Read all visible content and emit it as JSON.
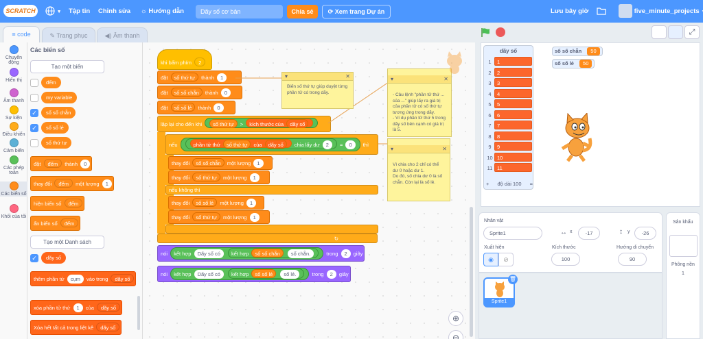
{
  "menu": {
    "logo": "SCRATCH",
    "language_icon": "globe-icon",
    "file": "Tập tin",
    "edit": "Chỉnh sửa",
    "tutorials": "Hướng dẫn",
    "project_title": "Dãy số cơ bản",
    "share": "Chia sẻ",
    "see_project": "Xem trang Dự án",
    "save_now": "Lưu bây giờ",
    "username": "five_minute_projects"
  },
  "tabs": {
    "code": "code",
    "costumes": "Trang phục",
    "sounds": "Âm thanh"
  },
  "categories": [
    {
      "label": "Chuyển động",
      "color": "#4c97ff"
    },
    {
      "label": "Hiển thị",
      "color": "#9966ff"
    },
    {
      "label": "Âm thanh",
      "color": "#cf63cf"
    },
    {
      "label": "Sự kiện",
      "color": "#ffbf00"
    },
    {
      "label": "Điều khiển",
      "color": "#ffab19"
    },
    {
      "label": "Cảm biến",
      "color": "#5cb1d6"
    },
    {
      "label": "Các phép toán",
      "color": "#59c059"
    },
    {
      "label": "Các biến số",
      "color": "#ff8c1a"
    },
    {
      "label": "Khối của tôi",
      "color": "#ff6680"
    }
  ],
  "palette": {
    "heading": "Các biến số",
    "make_var": "Tạo một biến",
    "vars": [
      "đếm",
      "my variable",
      "số số chẵn",
      "số số lẻ",
      "số thứ tự"
    ],
    "set_block": {
      "a": "đặt",
      "var": "đếm",
      "b": "thành",
      "val": "0"
    },
    "change_block": {
      "a": "thay đổi",
      "var": "đếm",
      "b": "một lượng",
      "val": "1"
    },
    "show_block": {
      "a": "hiện biến số",
      "var": "đếm"
    },
    "hide_block": {
      "a": "ẩn biến số",
      "var": "đếm"
    },
    "make_list": "Tạo một Danh sách",
    "list_name": "dãy số",
    "add_block": {
      "a": "thêm phần tử",
      "val": "cụm",
      "b": "vào trong",
      "list": "dãy số"
    },
    "delete_block": {
      "a": "xóa phần tử thứ",
      "val": "1",
      "b": "của",
      "list": "dãy số"
    },
    "deleteall_block": {
      "a": "Xóa hết tất cả trong liệt kê",
      "list": "dãy số"
    }
  },
  "script": {
    "hat": {
      "a": "khi bấm phím",
      "key": "2"
    },
    "set1": {
      "a": "đặt",
      "var": "số thứ tự",
      "b": "thành",
      "val": "1"
    },
    "set2": {
      "a": "đặt",
      "var": "số số chẵn",
      "b": "thành",
      "val": "0"
    },
    "set3": {
      "a": "đặt",
      "var": "số số lẻ",
      "b": "thành",
      "val": "0"
    },
    "repeat": {
      "a": "lặp lại cho đến khi",
      "var": "số thứ tự",
      "op": ">",
      "len": "kích thước của",
      "list": "dãy số"
    },
    "if": {
      "a": "nếu",
      "item": "phần tử thứ",
      "var": "số thứ tự",
      "of": "của",
      "list": "dãy số",
      "mod": "chia lấy dư",
      "div": "2",
      "eq": "=",
      "zero": "0",
      "then": "thì"
    },
    "ch1": {
      "a": "thay đổi",
      "var": "số số chẵn",
      "b": "một lượng",
      "val": "1"
    },
    "ch2": {
      "a": "thay đổi",
      "var": "số thứ tự",
      "b": "một lượng",
      "val": "1"
    },
    "else": "nếu không thì",
    "ch3": {
      "a": "thay đổi",
      "var": "số số lẻ",
      "b": "một lượng",
      "val": "1"
    },
    "ch4": {
      "a": "thay đổi",
      "var": "số thứ tự",
      "b": "một lượng",
      "val": "1"
    },
    "say1": {
      "a": "nói",
      "join1": "kết hợp",
      "s1": "Dãy số có",
      "join2": "kết hợp",
      "var": "số số chẵn",
      "s2": "số chẵn.",
      "in": "trong",
      "secs": "2",
      "unit": "giây"
    },
    "say2": {
      "a": "nói",
      "join1": "kết hợp",
      "s1": "Dãy số có",
      "join2": "kết hợp",
      "var": "số số lẻ",
      "s2": "số lẻ.",
      "in": "trong",
      "secs": "2",
      "unit": "giây"
    }
  },
  "notes": {
    "n1": "Biến số thứ tự giúp duyệt từng phần tử có trong dãy.",
    "n2": "- Câu lệnh \"phần tử thứ ... của ...\" giúp lấy ra giá trị của phần tử có số thứ tự tương ứng trong dãy.\n- Ví dụ phần tử thứ 5 trong dãy số bên cạnh có giá trị là 5.",
    "n3": "Vì chia cho 2 chỉ có thể dư 0 hoặc dư 1.\nDo đó, số chia dư 0 là số chẵn. Còn lại là số lẻ."
  },
  "stage": {
    "list_title": "dãy số",
    "list_items": [
      "1",
      "2",
      "3",
      "4",
      "5",
      "6",
      "7",
      "8",
      "9",
      "10",
      "11"
    ],
    "list_footer_plus": "+",
    "list_length": "độ dài 100",
    "list_footer_eq": "=",
    "even_label": "số số chẵn",
    "even_val": "50",
    "odd_label": "số số lẻ",
    "odd_val": "50"
  },
  "sprite": {
    "label": "Nhân vật",
    "name": "Sprite1",
    "x": "-17",
    "y": "-26",
    "show_label": "Xuất hiện",
    "size_label": "Kích thước",
    "size": "100",
    "dir_label": "Hướng di chuyển",
    "dir": "90",
    "thumb_name": "Sprite1"
  },
  "stage_pane": {
    "title": "Sân khấu",
    "backdrops_label": "Phông nền",
    "backdrops": "1"
  }
}
